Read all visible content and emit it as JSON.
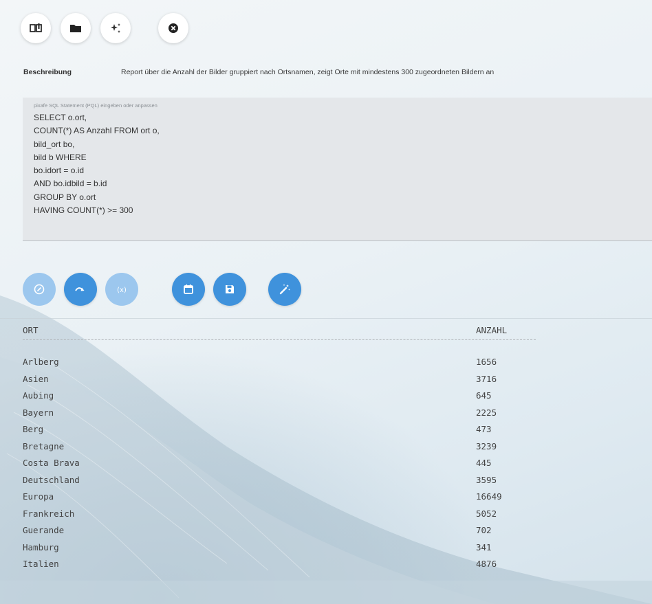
{
  "toolbar": {
    "buttons": [
      {
        "name": "report-layout-icon"
      },
      {
        "name": "folder-icon"
      },
      {
        "name": "sparkle-icon"
      },
      {
        "name": "close-circle-icon"
      }
    ]
  },
  "description": {
    "label": "Beschreibung",
    "text": "Report über die Anzahl der Bilder gruppiert nach Ortsnamen, zeigt Orte mit mindestens 300 zugeordneten Bildern an"
  },
  "sql_editor": {
    "label": "pixafe SQL Statement (PQL) eingeben oder anpassen",
    "value": "SELECT o.ort,\nCOUNT(*) AS Anzahl FROM ort o,\nbild_ort bo,\nbild b WHERE\nbo.idort = o.id\nAND bo.idbild = b.id\nGROUP BY o.ort\nHAVING COUNT(*) >= 300"
  },
  "actions": [
    {
      "name": "validate-icon",
      "enabled": false
    },
    {
      "name": "execute-icon",
      "enabled": true
    },
    {
      "name": "variables-icon",
      "enabled": false
    },
    {
      "name": "calendar-icon",
      "enabled": true
    },
    {
      "name": "save-icon",
      "enabled": true
    },
    {
      "name": "magic-wand-icon",
      "enabled": true
    }
  ],
  "results": {
    "columns": [
      "ORT",
      "ANZAHL"
    ],
    "rows": [
      [
        "Arlberg",
        "1656"
      ],
      [
        "Asien",
        "3716"
      ],
      [
        "Aubing",
        "645"
      ],
      [
        "Bayern",
        "2225"
      ],
      [
        "Berg",
        "473"
      ],
      [
        "Bretagne",
        "3239"
      ],
      [
        "Costa Brava",
        "445"
      ],
      [
        "Deutschland",
        "3595"
      ],
      [
        "Europa",
        "16649"
      ],
      [
        "Frankreich",
        "5052"
      ],
      [
        "Guerande",
        "702"
      ],
      [
        "Hamburg",
        "341"
      ],
      [
        "Italien",
        "4876"
      ]
    ]
  },
  "colors": {
    "accent": "#3f92dc",
    "accent_disabled": "#9cc7ee",
    "editor_bg": "#e4e7ea"
  }
}
